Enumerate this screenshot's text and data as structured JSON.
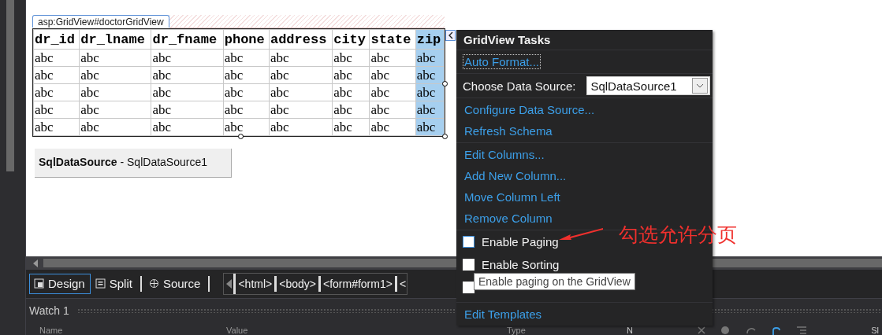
{
  "designer": {
    "control_tag": "asp:GridView#doctorGridView",
    "grid": {
      "columns": [
        {
          "label": "dr_id",
          "selected": false
        },
        {
          "label": "dr_lname",
          "selected": false
        },
        {
          "label": "dr_fname",
          "selected": false
        },
        {
          "label": "phone",
          "selected": false
        },
        {
          "label": "address",
          "selected": false
        },
        {
          "label": "city",
          "selected": false
        },
        {
          "label": "state",
          "selected": false
        },
        {
          "label": "zip",
          "selected": true
        }
      ],
      "rows": [
        [
          "abc",
          "abc",
          "abc",
          "abc",
          "abc",
          "abc",
          "abc",
          "abc"
        ],
        [
          "abc",
          "abc",
          "abc",
          "abc",
          "abc",
          "abc",
          "abc",
          "abc"
        ],
        [
          "abc",
          "abc",
          "abc",
          "abc",
          "abc",
          "abc",
          "abc",
          "abc"
        ],
        [
          "abc",
          "abc",
          "abc",
          "abc",
          "abc",
          "abc",
          "abc",
          "abc"
        ],
        [
          "abc",
          "abc",
          "abc",
          "abc",
          "abc",
          "abc",
          "abc",
          "abc"
        ]
      ]
    },
    "data_source_control": "**SqlDataSource** - SqlDataSource1"
  },
  "tasks_panel": {
    "title": "GridView Tasks",
    "groups": [
      [
        {
          "kind": "link",
          "label": "Auto Format...",
          "focused": true
        }
      ],
      [
        {
          "kind": "dropdown",
          "label": "Choose Data Source:",
          "value": "SqlDataSource1"
        }
      ],
      [
        {
          "kind": "link",
          "label": "Configure Data Source...",
          "focused": false
        },
        {
          "kind": "link",
          "label": "Refresh Schema",
          "focused": false
        }
      ],
      [
        {
          "kind": "link",
          "label": "Edit Columns...",
          "focused": false
        },
        {
          "kind": "link",
          "label": "Add New Column...",
          "focused": false
        },
        {
          "kind": "link",
          "label": "Move Column Left",
          "focused": false
        },
        {
          "kind": "link",
          "label": "Remove Column",
          "focused": false
        }
      ],
      [
        {
          "kind": "checkbox",
          "label": "Enable Paging",
          "checked": false,
          "focused": true
        },
        {
          "kind": "checkbox",
          "label": "Enable Sorting",
          "checked": false,
          "focused": false
        },
        {
          "kind": "checkbox",
          "checked": false,
          "focused": false
        }
      ],
      [
        {
          "kind": "link",
          "label": "Edit Templates",
          "focused": false
        }
      ]
    ]
  },
  "tooltip": "Enable paging on the GridView",
  "annotation": "勾选允许分页",
  "view_tabs": [
    {
      "label": "Design",
      "selected": true
    },
    {
      "label": "Split",
      "selected": false
    },
    {
      "label": "Source",
      "selected": false
    }
  ],
  "breadcrumb": [
    "<html>",
    "<body>",
    "<form#form1>",
    "<"
  ],
  "watch_panel": {
    "title": "Watch 1",
    "columns": [
      "Name",
      "Value",
      "Type"
    ]
  },
  "side_panel": {
    "column_1": "N",
    "column_2": "Sl"
  }
}
